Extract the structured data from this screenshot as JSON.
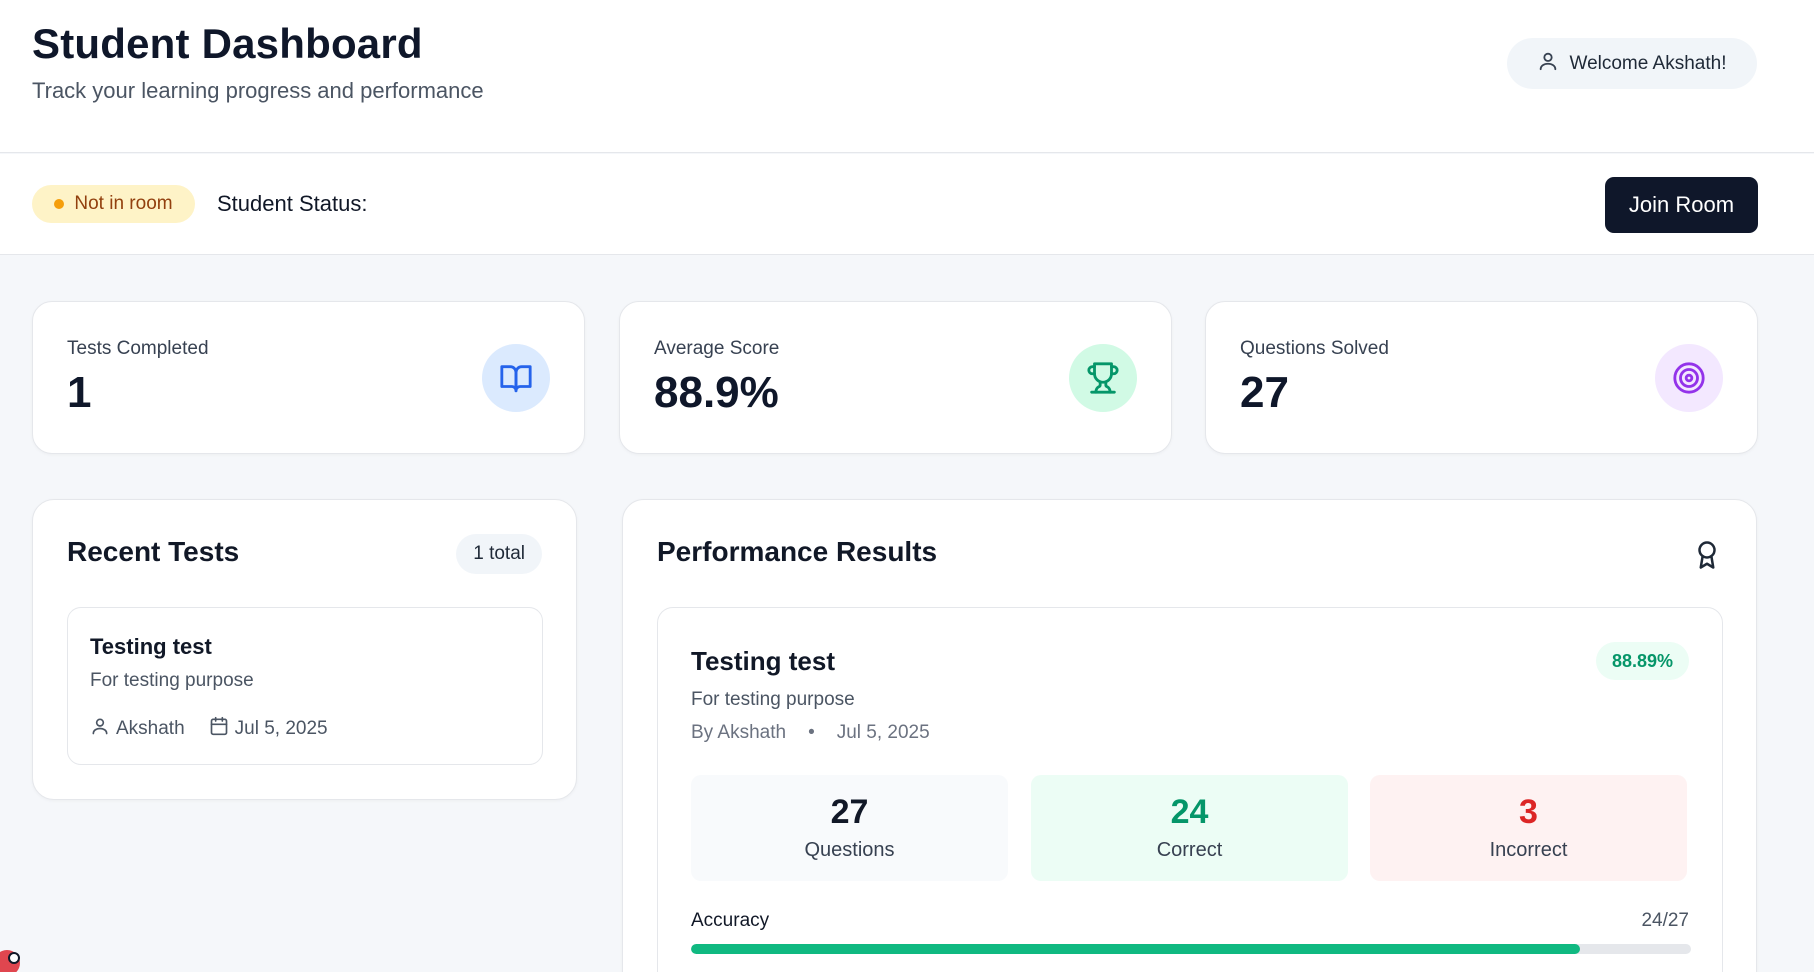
{
  "header": {
    "title": "Student Dashboard",
    "subtitle": "Track your learning progress and performance",
    "welcome": "Welcome Akshath!"
  },
  "status_bar": {
    "badge": "Not in room",
    "label": "Student Status:",
    "join_button": "Join Room",
    "badge_color": "#f59e0b"
  },
  "stats": [
    {
      "label": "Tests Completed",
      "value": "1",
      "icon": "book-icon",
      "color": "#2563eb"
    },
    {
      "label": "Average Score",
      "value": "88.9%",
      "icon": "trophy-icon",
      "color": "#059669"
    },
    {
      "label": "Questions Solved",
      "value": "27",
      "icon": "target-icon",
      "color": "#9333ea"
    }
  ],
  "recent_tests": {
    "title": "Recent Tests",
    "count": "1 total",
    "items": [
      {
        "title": "Testing test",
        "description": "For testing purpose",
        "author": "Akshath",
        "date": "Jul 5, 2025"
      }
    ]
  },
  "performance": {
    "title": "Performance Results",
    "result": {
      "title": "Testing test",
      "score": "88.89%",
      "description": "For testing purpose",
      "by": "By Akshath",
      "separator": "•",
      "date": "Jul 5, 2025",
      "metrics": [
        {
          "value": "27",
          "label": "Questions",
          "color": "#111827",
          "bg": "#f8fafc"
        },
        {
          "value": "24",
          "label": "Correct",
          "color": "#059669",
          "bg": "#ecfdf5"
        },
        {
          "value": "3",
          "label": "Incorrect",
          "color": "#dc2626",
          "bg": "#fef2f2"
        }
      ],
      "accuracy_label": "Accuracy",
      "accuracy_value": "24/27",
      "accuracy_fraction": 0.8889
    }
  }
}
